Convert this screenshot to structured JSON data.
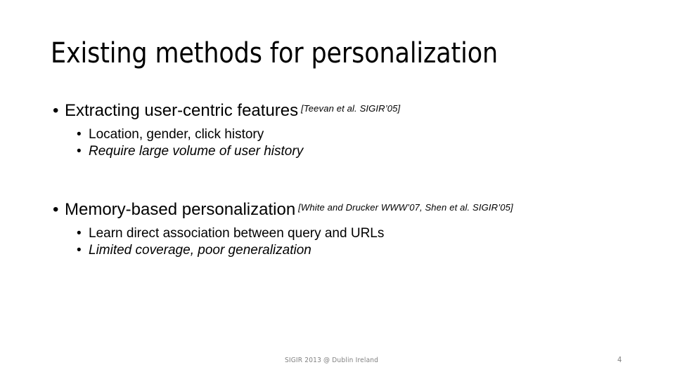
{
  "slide": {
    "title": "Existing methods for personalization",
    "groups": [
      {
        "bullet": "Extracting user-centric features",
        "citation": "[Teevan et al. SIGIR’05]",
        "subitems": [
          {
            "text": "Location, gender, click history",
            "italic": false
          },
          {
            "text": "Require large volume of user history",
            "italic": true
          }
        ]
      },
      {
        "bullet": "Memory-based personalization",
        "citation": "[White and Drucker WWW’07, Shen et al. SIGIR’05]",
        "subitems": [
          {
            "text": "Learn direct association between query and URLs",
            "italic": false
          },
          {
            "text": "Limited coverage, poor generalization",
            "italic": true
          }
        ]
      }
    ],
    "bullet_glyph": "•",
    "footer": "SIGIR 2013 @ Dublin Ireland",
    "page_number": "4",
    "colors": {
      "background": "#ffffff",
      "text": "#000000",
      "footer_text": "#808080"
    }
  }
}
